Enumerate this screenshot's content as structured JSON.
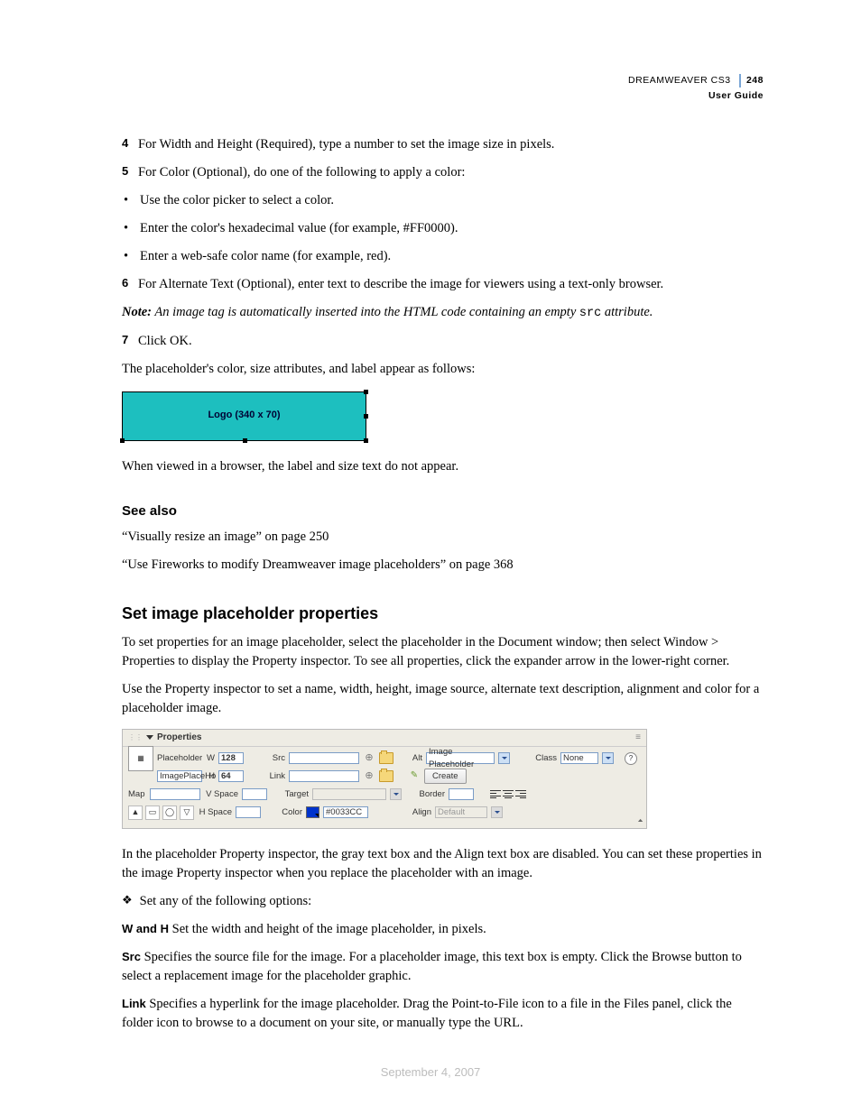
{
  "header": {
    "product": "DREAMWEAVER CS3",
    "page_num": "248",
    "guide": "User Guide"
  },
  "steps": {
    "s4": {
      "num": "4",
      "text": "For Width and Height (Required), type a number to set the image size in pixels."
    },
    "s5": {
      "num": "5",
      "text": "For Color (Optional), do one of the following to apply a color:"
    },
    "b1": "Use the color picker to select a color.",
    "b2": "Enter the color's hexadecimal value (for example, #FF0000).",
    "b3": "Enter a web-safe color name (for example, red).",
    "s6": {
      "num": "6",
      "text": "For Alternate Text (Optional), enter text to describe the image for viewers using a text-only browser."
    },
    "note_label": "Note:",
    "note_before": " An image tag is automatically inserted into the HTML code containing an empty ",
    "note_code": "src",
    "note_after": " attribute.",
    "s7": {
      "num": "7",
      "text": "Click OK."
    },
    "after7": "The placeholder's color, size attributes, and label appear as follows:"
  },
  "placeholder_fig_label": "Logo (340 x 70)",
  "after_fig": "When viewed in a browser, the label and size text do not appear.",
  "see_also": {
    "heading": "See also",
    "ref1": "“Visually resize an image” on page 250",
    "ref2": "“Use Fireworks to modify Dreamweaver image placeholders” on page 368"
  },
  "section": {
    "heading": "Set image placeholder properties",
    "p1": "To set properties for an image placeholder, select the placeholder in the Document window; then select Window > Properties to display the Property inspector. To see all properties, click the expander arrow in the lower-right corner.",
    "p2": "Use the Property inspector to set a name, width, height, image source, alternate text description, alignment and color for a placeholder image."
  },
  "props": {
    "title": "Properties",
    "placeholder_label": "Placeholder",
    "name_value": "ImagePlaceHo",
    "w_label": "W",
    "w_value": "128",
    "h_label": "H",
    "h_value": "64",
    "src_label": "Src",
    "link_label": "Link",
    "alt_label": "Alt",
    "alt_value": "Image Placeholder",
    "class_label": "Class",
    "class_value": "None",
    "create_btn": "Create",
    "map_label": "Map",
    "vspace_label": "V Space",
    "hspace_label": "H Space",
    "target_label": "Target",
    "color_label": "Color",
    "color_value": "#0033CC",
    "border_label": "Border",
    "align_label": "Align",
    "align_value": "Default"
  },
  "after_panel": "In the placeholder Property inspector, the gray text box and the Align text box are disabled. You can set these properties in the image Property inspector when you replace the placeholder with an image.",
  "options_lead": "Set any of the following options:",
  "defs": {
    "wh_term": "W and H",
    "wh_def": "  Set the width and height of the image placeholder, in pixels.",
    "src_term": "Src",
    "src_def": "  Specifies the source file for the image. For a placeholder image, this text box is empty. Click the Browse button to select a replacement image for the placeholder graphic.",
    "link_term": "Link",
    "link_def": "  Specifies a hyperlink for the image placeholder. Drag the Point-to-File icon to a file in the Files panel, click the folder icon to browse to a document on your site, or manually type the URL."
  },
  "footer_date": "September 4, 2007"
}
